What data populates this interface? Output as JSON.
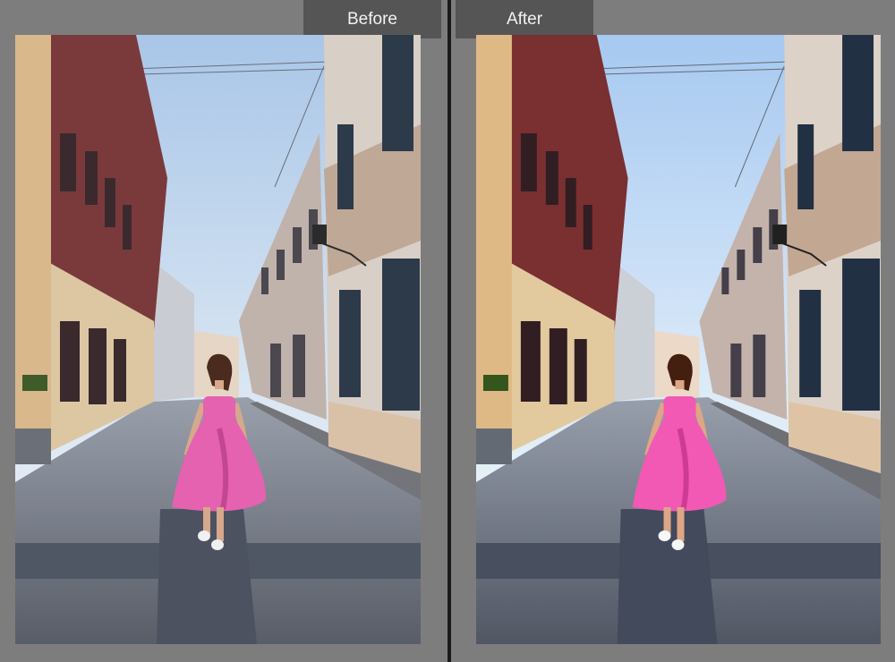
{
  "compare": {
    "before_label": "Before",
    "after_label": "After"
  },
  "icons": {
    "photo": "street-scene-photo"
  },
  "colors": {
    "background": "#7d7d7d",
    "tab_background": "#555555",
    "tab_text": "#f2f2f2",
    "divider": "#1a1a1a",
    "dress": "#e462b0"
  }
}
